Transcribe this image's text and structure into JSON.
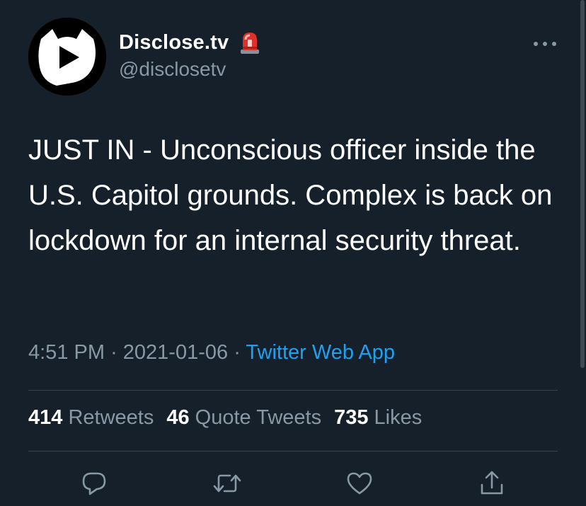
{
  "account": {
    "display_name": "Disclose.tv",
    "handle": "@disclosetv",
    "verified_badge_icon": "siren-icon",
    "avatar_icon": "play-cat-logo-icon"
  },
  "tweet": {
    "text": "JUST IN - Unconscious officer inside the U.S. Capitol grounds. Complex is back on lockdown for an internal security threat.",
    "time": "4:51 PM",
    "date": "2021-01-06",
    "separator": "·",
    "source": "Twitter Web App"
  },
  "stats": {
    "retweets": {
      "count": "414",
      "label": "Retweets"
    },
    "quote_tweets": {
      "count": "46",
      "label": "Quote Tweets"
    },
    "likes": {
      "count": "735",
      "label": "Likes"
    }
  },
  "actions": [
    {
      "name": "reply",
      "icon": "reply-icon"
    },
    {
      "name": "retweet",
      "icon": "retweet-icon"
    },
    {
      "name": "like",
      "icon": "heart-icon"
    },
    {
      "name": "share",
      "icon": "share-icon"
    }
  ],
  "colors": {
    "background": "#15202b",
    "text": "#ffffff",
    "secondary": "#8899a6",
    "link": "#1da1f2",
    "divider": "#38444d"
  }
}
